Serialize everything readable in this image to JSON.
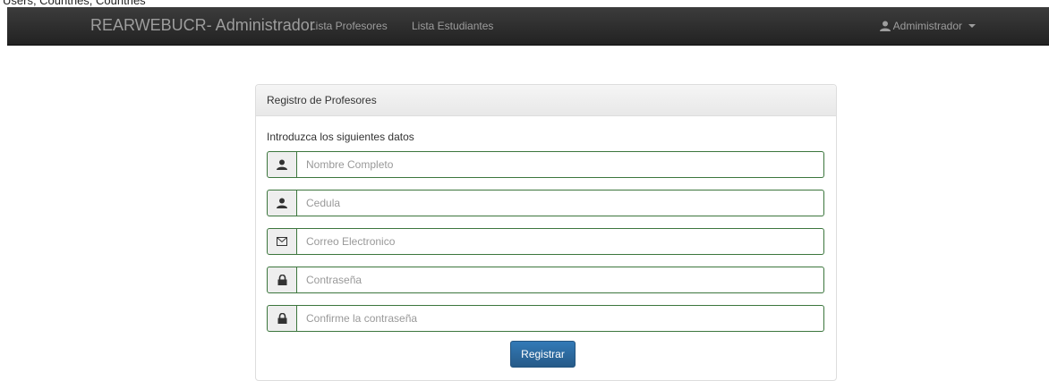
{
  "top_strip": {
    "text": "Users, Countries, Countries"
  },
  "navbar": {
    "brand": "REARWEBUCR- Administrador",
    "links": [
      "Lista Profesores",
      "Lista Estudiantes"
    ],
    "user_menu": {
      "label": "Admimistrador",
      "icon": "user-icon"
    },
    "colors": {
      "background": "#222222",
      "text": "#9d9d9d"
    }
  },
  "panel": {
    "heading": "Registro de Profesores",
    "intro": "Introduzca los siguientes datos",
    "fields": [
      {
        "icon": "user-icon",
        "placeholder": "Nombre Completo",
        "value": ""
      },
      {
        "icon": "user-icon",
        "placeholder": "Cedula",
        "value": ""
      },
      {
        "icon": "envelope-icon",
        "placeholder": "Correo Electronico",
        "value": ""
      },
      {
        "icon": "lock-icon",
        "placeholder": "Contraseña",
        "value": ""
      },
      {
        "icon": "lock-icon",
        "placeholder": "Confirme la contraseña",
        "value": ""
      }
    ],
    "submit_label": "Registrar",
    "colors": {
      "field_border": "#3c763d",
      "button": "#337ab7"
    }
  }
}
